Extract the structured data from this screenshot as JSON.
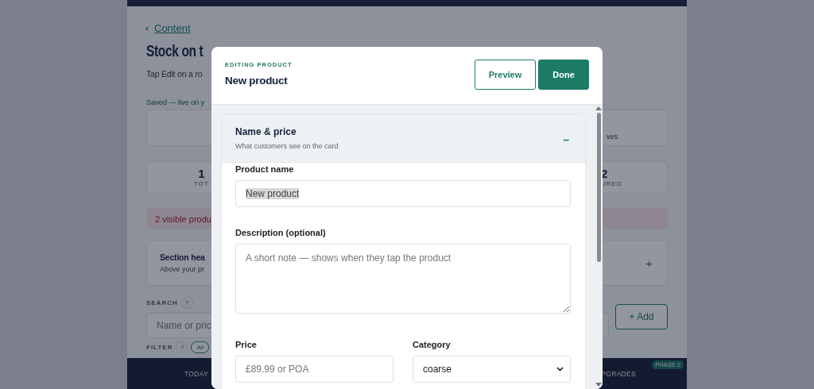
{
  "background": {
    "back_link": "Content",
    "title": "Stock on t",
    "subtitle": "Tap Edit on a ro",
    "save_status": "Saved — live on y",
    "summary_card": {
      "text": "ves"
    },
    "stats": [
      {
        "value": "1",
        "label": "TOT"
      },
      {
        "value": "2",
        "label": "URED"
      }
    ],
    "alert": "2 visible produ",
    "section_card": {
      "title": "Section hea",
      "subtitle": "Above your pr",
      "action": "+"
    },
    "search": {
      "label": "SEARCH",
      "help": "?",
      "placeholder": "Name or pric"
    },
    "add_button": "+ Add",
    "filter": {
      "label": "FILTER",
      "help": "?",
      "chips": [
        "All"
      ]
    }
  },
  "bottom_nav": [
    {
      "label": "TODAY"
    },
    {
      "label": "PGRADES",
      "badge": "PHASE 2"
    }
  ],
  "modal": {
    "eyebrow": "EDITING PRODUCT",
    "title": "New product",
    "buttons": [
      {
        "label": "Preview",
        "kind": "secondary"
      },
      {
        "label": "Done",
        "kind": "primary"
      }
    ],
    "section": {
      "title": "Name & price",
      "subtitle": "What customers see on the card",
      "toggle": "–",
      "expanded": true,
      "rows": [
        [
          {
            "kind": "text",
            "label": "Product name",
            "value": "New product",
            "text_selected": true
          }
        ],
        [
          {
            "kind": "textarea",
            "label": "Description (optional)",
            "placeholder": "A short note — shows when they tap the product"
          }
        ],
        [
          {
            "kind": "text",
            "label": "Price",
            "placeholder": "£89.99 or POA"
          },
          {
            "kind": "select",
            "label": "Category",
            "value": "coarse"
          }
        ]
      ]
    }
  }
}
